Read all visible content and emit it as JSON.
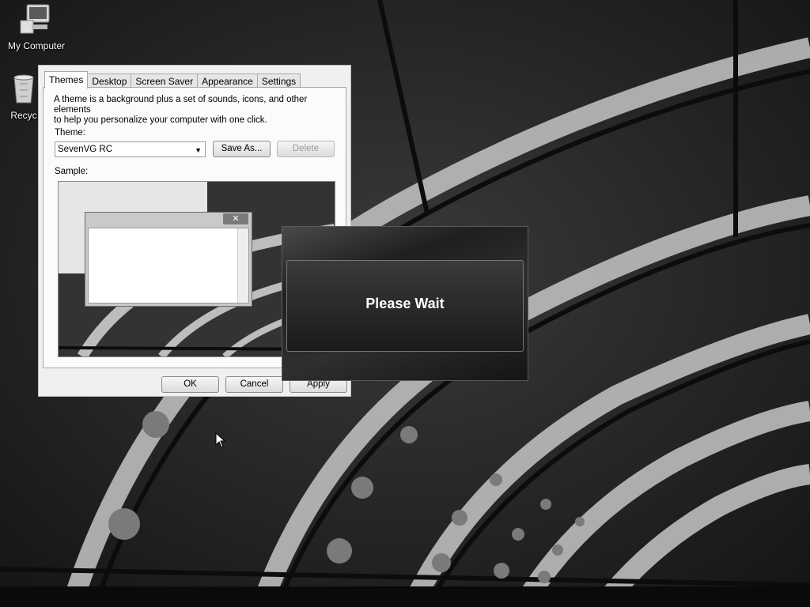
{
  "desktop": {
    "icons": [
      {
        "label": "My Computer",
        "icon": "computer-icon"
      },
      {
        "label": "Recyc",
        "icon": "recycle-bin-icon"
      }
    ]
  },
  "dialog": {
    "tabs": [
      {
        "label": "Themes",
        "active": true
      },
      {
        "label": "Desktop"
      },
      {
        "label": "Screen Saver"
      },
      {
        "label": "Appearance"
      },
      {
        "label": "Settings"
      }
    ],
    "description_line1": "A theme is a background plus a set of sounds, icons, and other elements",
    "description_line2": "to help you personalize your computer with one click.",
    "theme_label": "Theme:",
    "theme_value": "SevenVG RC",
    "save_as_label": "Save As...",
    "delete_label": "Delete",
    "sample_label": "Sample:",
    "sample_close_glyph": "✕",
    "ok_label": "OK",
    "cancel_label": "Cancel",
    "apply_label": "Apply"
  },
  "overlay": {
    "message": "Please Wait"
  },
  "colors": {
    "dialog_bg": "#f0f0f0",
    "overlay_bg": "#1f1f1f",
    "overlay_text": "#ffffff"
  }
}
